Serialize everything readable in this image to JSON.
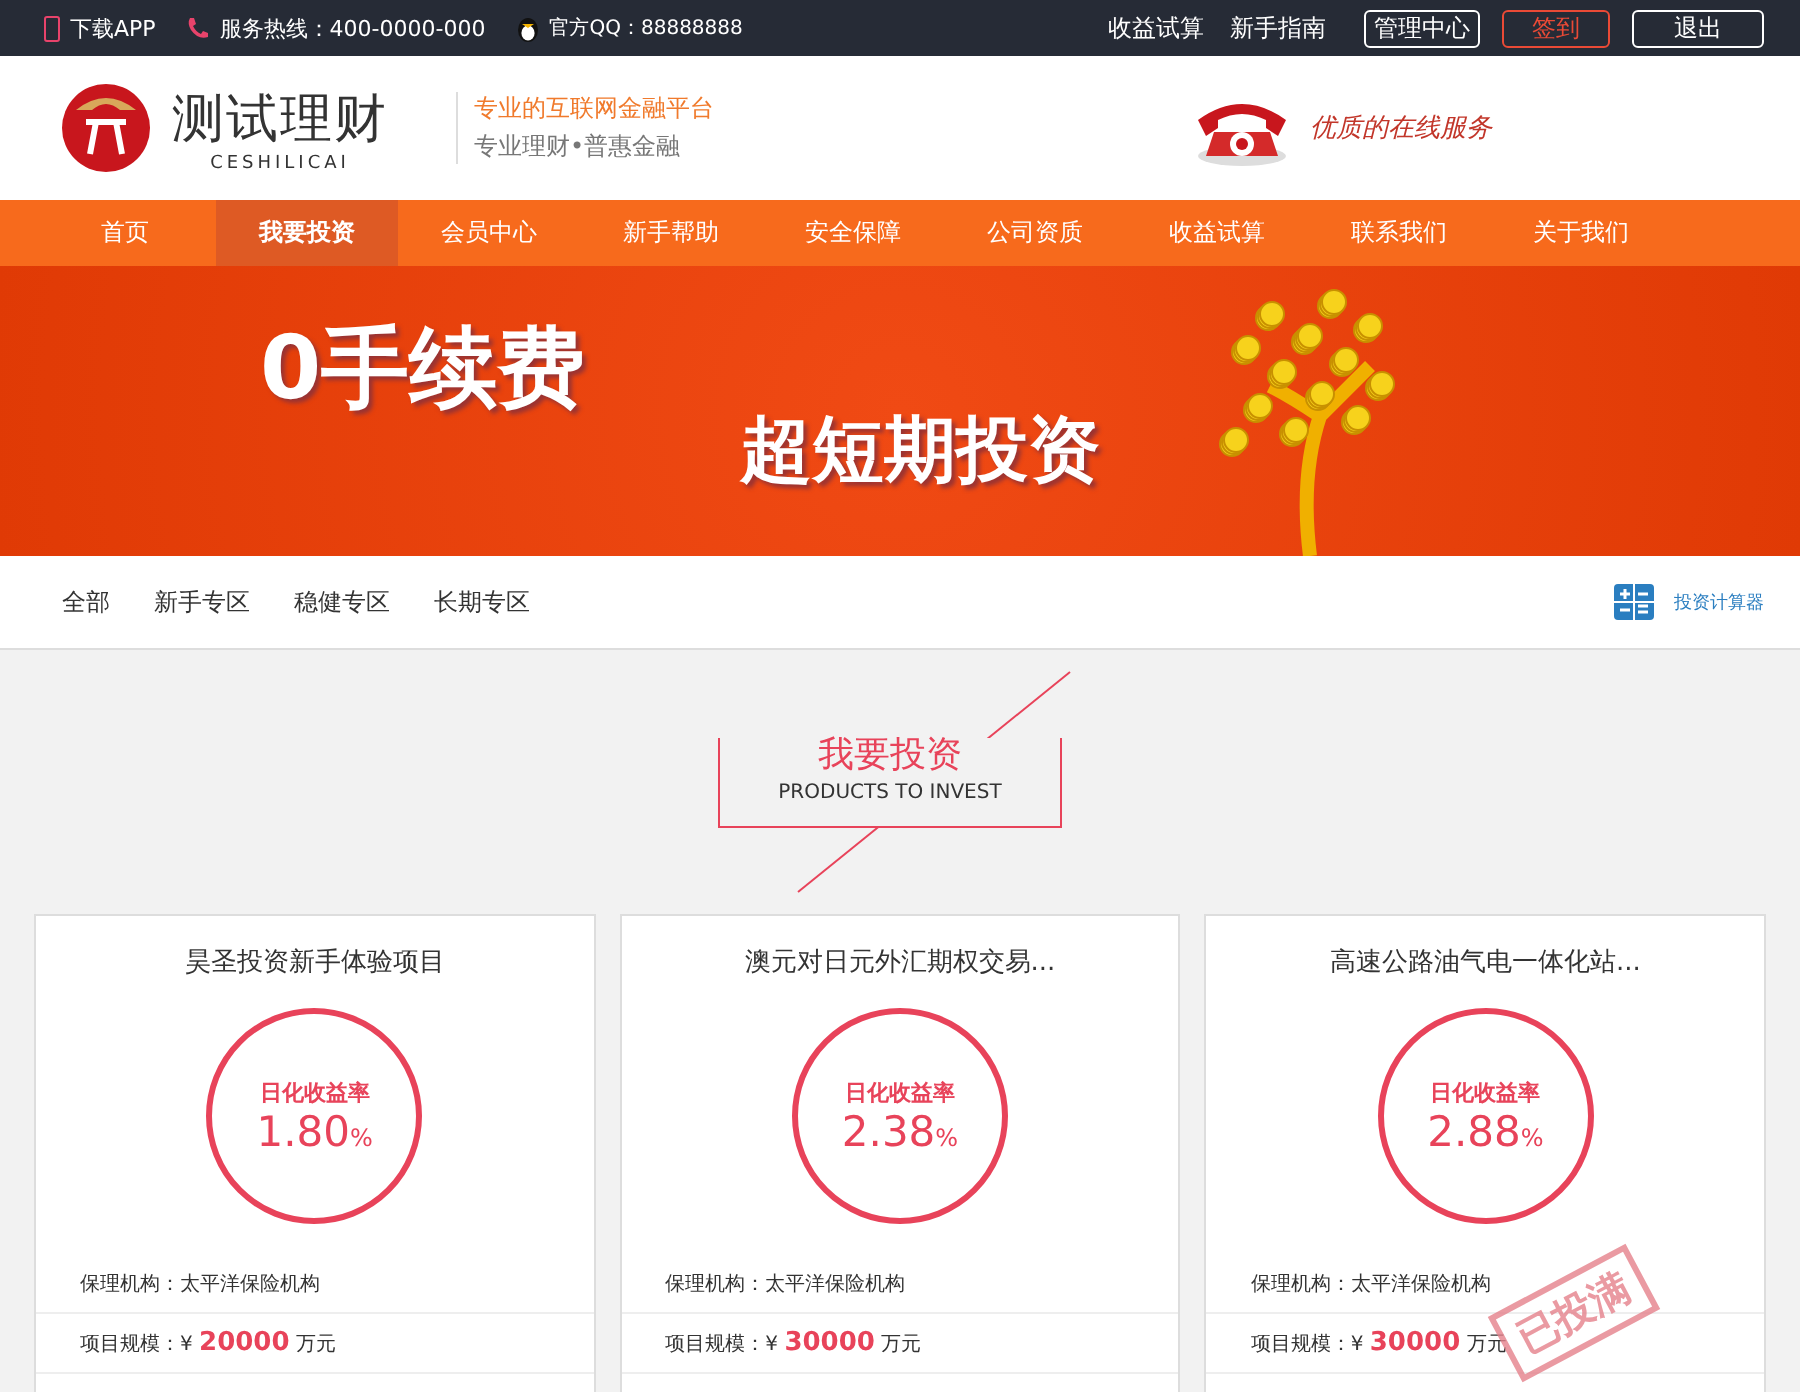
{
  "top_bar": {
    "app_link": "下载APP",
    "hotline": "服务热线：400-0000-000",
    "qq": "官方QQ：88888888",
    "links": [
      "收益试算",
      "新手指南"
    ],
    "buttons": [
      {
        "label": "管理中心",
        "kind": "outline"
      },
      {
        "label": "签到",
        "kind": "accent"
      },
      {
        "label": "退出",
        "kind": "outline"
      }
    ]
  },
  "header": {
    "logo_name": "测试理财",
    "logo_sub": "CESHILICAI",
    "slogan_1": "专业的互联网金融平台",
    "slogan_2": "专业理财•普惠金融",
    "service": "优质的在线服务"
  },
  "nav": [
    {
      "label": "首页",
      "selected": false
    },
    {
      "label": "我要投资",
      "selected": true
    },
    {
      "label": "会员中心",
      "selected": false
    },
    {
      "label": "新手帮助",
      "selected": false
    },
    {
      "label": "安全保障",
      "selected": false
    },
    {
      "label": "公司资质",
      "selected": false
    },
    {
      "label": "收益试算",
      "selected": false
    },
    {
      "label": "联系我们",
      "selected": false
    },
    {
      "label": "关于我们",
      "selected": false
    }
  ],
  "banner": {
    "headline_1": "0手续费",
    "headline_2": "超短期投资"
  },
  "filters": [
    "全部",
    "新手专区",
    "稳健专区",
    "长期专区"
  ],
  "calculator_link": "投资计算器",
  "section": {
    "title": "我要投资",
    "subtitle": "PRODUCTS TO INVEST"
  },
  "products": [
    {
      "name": "昊圣投资新手体验项目",
      "rate_label": "日化收益率",
      "rate": "1.80",
      "unit": "%",
      "guarantor_label": "保理机构：",
      "guarantor": "太平洋保险机构",
      "scale_label": "项目规模：¥",
      "scale": "20000",
      "scale_unit": "万元",
      "full": false
    },
    {
      "name": "澳元对日元外汇期权交易...",
      "rate_label": "日化收益率",
      "rate": "2.38",
      "unit": "%",
      "guarantor_label": "保理机构：",
      "guarantor": "太平洋保险机构",
      "scale_label": "项目规模：¥",
      "scale": "30000",
      "scale_unit": "万元",
      "full": false
    },
    {
      "name": "高速公路油气电一体化站...",
      "rate_label": "日化收益率",
      "rate": "2.88",
      "unit": "%",
      "guarantor_label": "保理机构：",
      "guarantor": "太平洋保险机构",
      "scale_label": "项目规模：¥",
      "scale": "30000",
      "scale_unit": "万元",
      "full": true,
      "stamp": "已投满"
    }
  ]
}
